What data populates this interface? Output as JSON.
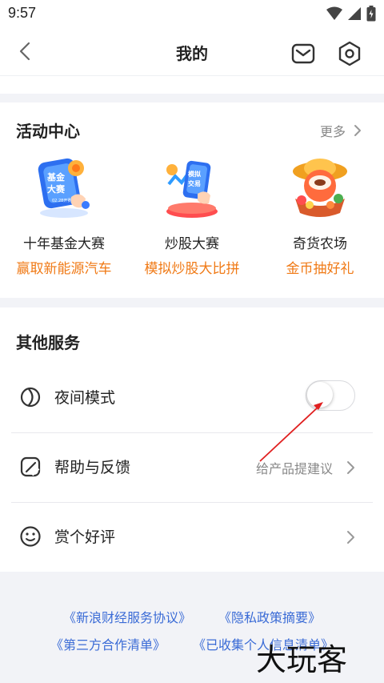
{
  "status_bar": {
    "time": "9:57",
    "icons": [
      "wifi-icon",
      "signal-icon",
      "battery-icon"
    ]
  },
  "nav": {
    "title": "我的",
    "icons": [
      "back-icon",
      "mail-icon",
      "settings-icon"
    ]
  },
  "activity_center": {
    "title": "活动中心",
    "more_label": "更多",
    "items": [
      {
        "name": "十年基金大赛",
        "subtitle": "赢取新能源汽车",
        "icon": "fund-contest-icon",
        "icon_text": [
          "基金",
          "大赛",
          "02.28开赛"
        ]
      },
      {
        "name": "炒股大赛",
        "subtitle": "模拟炒股大比拼",
        "icon": "stock-contest-icon",
        "icon_text": [
          "模拟",
          "交易"
        ]
      },
      {
        "name": "奇货农场",
        "subtitle": "金币抽好礼",
        "icon": "farm-icon"
      }
    ]
  },
  "other_services": {
    "title": "其他服务",
    "rows": [
      {
        "label": "夜间模式",
        "icon": "night-mode-icon",
        "control": "toggle",
        "toggle_on": false
      },
      {
        "label": "帮助与反馈",
        "icon": "feedback-icon",
        "hint": "给产品提建议"
      },
      {
        "label": "赏个好评",
        "icon": "smile-icon"
      }
    ]
  },
  "footer_links": {
    "row1": [
      "《新浪财经服务协议》",
      "《隐私政策摘要》"
    ],
    "row2": [
      "《第三方合作清单》",
      "《已收集个人信息清单》"
    ]
  },
  "watermark": "大玩客",
  "colors": {
    "accent_orange": "#f07a16",
    "link_blue": "#3a6bd6",
    "annotation_red": "#e02020"
  }
}
